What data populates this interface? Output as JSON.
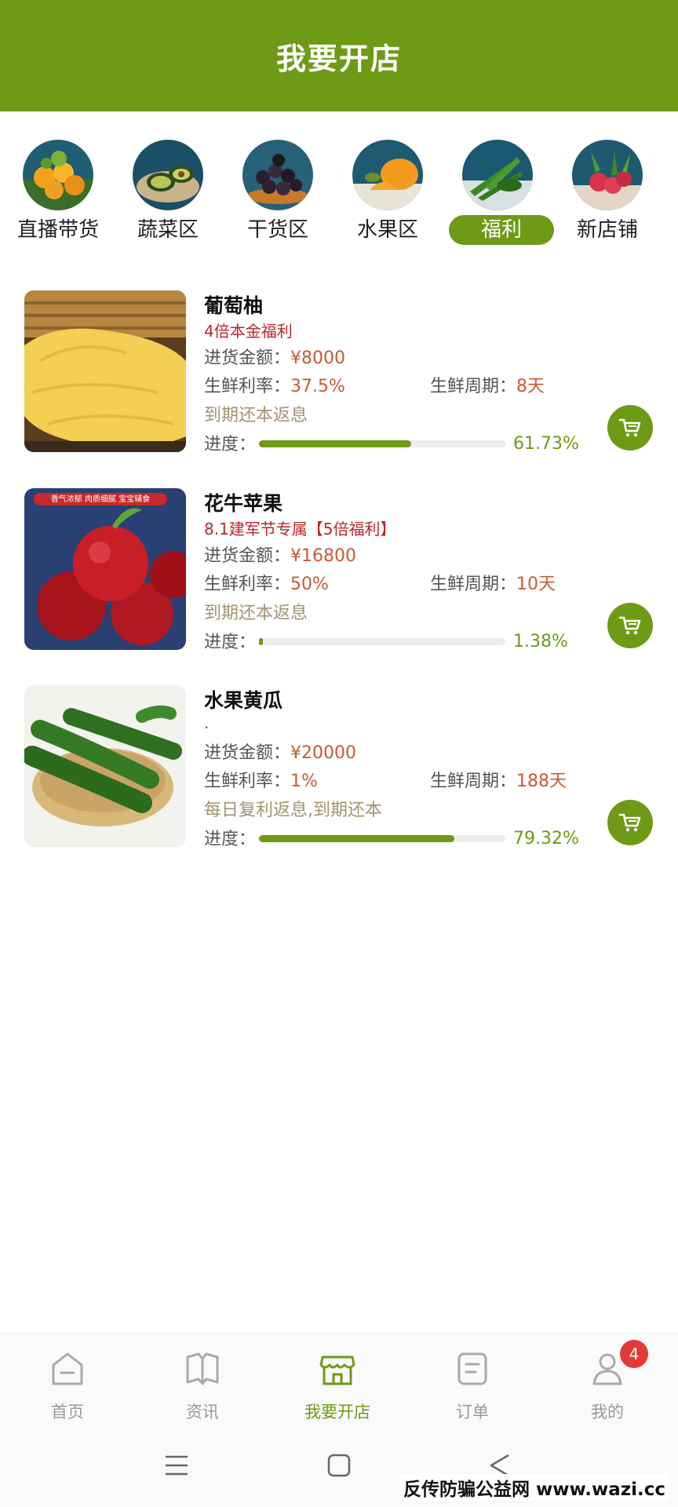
{
  "header": {
    "title": "我要开店"
  },
  "categories": [
    {
      "label": "直播带货",
      "icon": "oranges"
    },
    {
      "label": "蔬菜区",
      "icon": "avocado"
    },
    {
      "label": "干货区",
      "icon": "dried-fruit"
    },
    {
      "label": "水果区",
      "icon": "pumpkin"
    },
    {
      "label": "福利",
      "icon": "okra",
      "active": true
    },
    {
      "label": "新店铺",
      "icon": "radish"
    }
  ],
  "labels": {
    "amount": "进货金额：",
    "rate": "生鲜利率：",
    "period": "生鲜周期：",
    "progress": "进度："
  },
  "products": [
    {
      "name": "葡萄柚",
      "promo": "4倍本金福利",
      "amount": "¥8000",
      "rate": "37.5%",
      "period": "8天",
      "note": "到期还本返息",
      "progress_text": "61.73%",
      "progress": 0.6173,
      "image": "grapefruit"
    },
    {
      "name": "花牛苹果",
      "promo": "8.1建军节专属【5倍福利】",
      "image_caption": "香气浓郁 肉质细腻 宝宝辅食",
      "amount": "¥16800",
      "rate": "50%",
      "period": "10天",
      "note": "到期还本返息",
      "progress_text": "1.38%",
      "progress": 0.0138,
      "image": "apple"
    },
    {
      "name": "水果黄瓜",
      "promo": ".",
      "amount": "¥20000",
      "rate": "1%",
      "period": "188天",
      "note": "每日复利返息,到期还本",
      "progress_text": "79.32%",
      "progress": 0.7932,
      "image": "cucumber"
    }
  ],
  "nav": [
    {
      "label": "首页",
      "icon": "home-icon"
    },
    {
      "label": "资讯",
      "icon": "book-icon"
    },
    {
      "label": "我要开店",
      "icon": "store-icon",
      "active": true
    },
    {
      "label": "订单",
      "icon": "order-icon"
    },
    {
      "label": "我的",
      "icon": "user-icon",
      "badge": "4"
    }
  ],
  "watermark": "反传防骗公益网 www.wazi.cc",
  "colors": {
    "brand": "#6e9a15",
    "price": "#c85a33",
    "promo": "#b8262b",
    "badge": "#e53935"
  }
}
